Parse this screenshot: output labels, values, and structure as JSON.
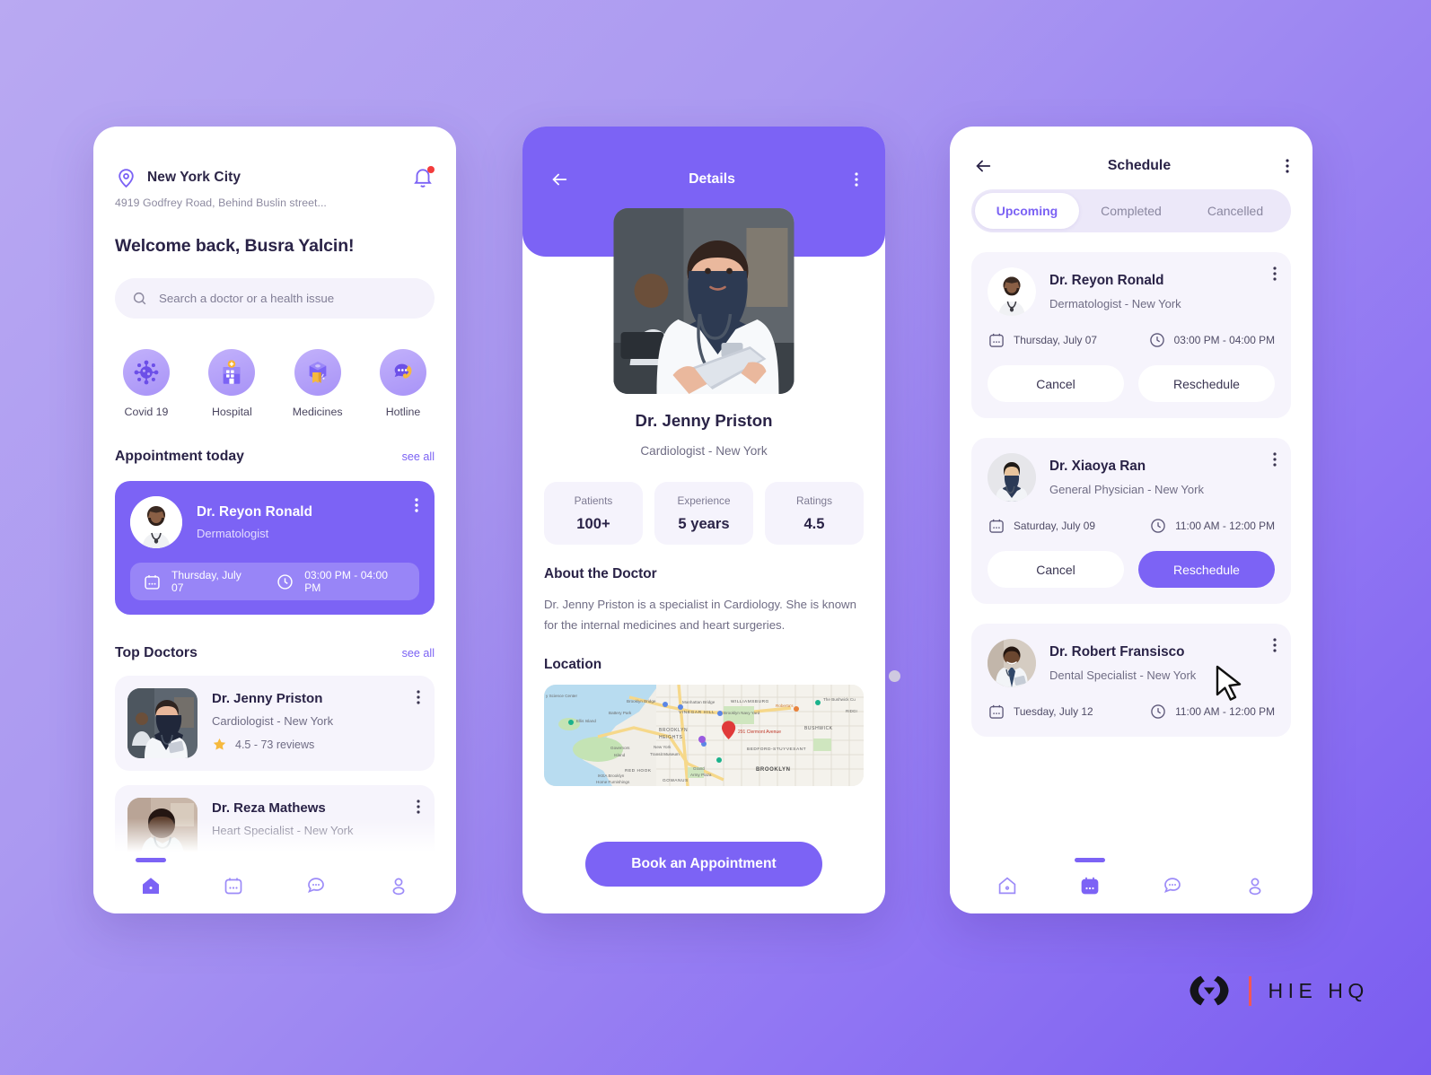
{
  "brand": {
    "name": "HIE HQ",
    "accent": "#7c63f5",
    "divider_color": "#f25757",
    "background_from": "#b9a9f2",
    "background_to": "#7a5cf0"
  },
  "home": {
    "location": {
      "city": "New York City",
      "address": "4919 Godfrey Road, Behind Buslin street..."
    },
    "greeting": "Welcome back, Busra Yalcin!",
    "search": {
      "placeholder": "Search a doctor or a health issue",
      "value": ""
    },
    "categories": [
      {
        "label": "Covid 19",
        "icon": "virus-icon"
      },
      {
        "label": "Hospital",
        "icon": "hospital-icon"
      },
      {
        "label": "Medicines",
        "icon": "medicine-box-icon"
      },
      {
        "label": "Hotline",
        "icon": "hotline-icon"
      }
    ],
    "appointment_section": {
      "title": "Appointment today",
      "see_all": "see all"
    },
    "appointment": {
      "doctor": "Dr. Reyon Ronald",
      "specialty": "Dermatologist",
      "date": "Thursday, July 07",
      "time": "03:00 PM - 04:00 PM"
    },
    "top_doctors_section": {
      "title": "Top Doctors",
      "see_all": "see all"
    },
    "top_doctors": [
      {
        "name": "Dr. Jenny Priston",
        "specialty": "Cardiologist - New York",
        "rating": "4.5 - 73 reviews"
      },
      {
        "name": "Dr. Reza Mathews",
        "specialty": "Heart Specialist - New York",
        "rating": ""
      }
    ],
    "tabs": [
      {
        "icon": "home-icon",
        "active": true
      },
      {
        "icon": "calendar-icon",
        "active": false
      },
      {
        "icon": "chat-icon",
        "active": false
      },
      {
        "icon": "profile-icon",
        "active": false
      }
    ]
  },
  "details": {
    "title": "Details",
    "doctor": {
      "name": "Dr. Jenny Priston",
      "specialty": "Cardiologist - New York"
    },
    "stats": [
      {
        "label": "Patients",
        "value": "100+"
      },
      {
        "label": "Experience",
        "value": "5 years"
      },
      {
        "label": "Ratings",
        "value": "4.5"
      }
    ],
    "about_heading": "About the Doctor",
    "about_text": "Dr. Jenny Priston is a specialist in Cardiology. She is known for the internal medicines and heart surgeries.",
    "location_heading": "Location",
    "map": {
      "marker_label": "291 Clermont Avenue",
      "places": [
        "y Science Center",
        "Brooklyn Bridge",
        "Manhattan Bridge",
        "WILLIAMSBURG",
        "The Bushwick Co",
        "Roberta's",
        "Battery Park",
        "VINEGAR HILL",
        "Brooklyn Navy Yard",
        "RIDGE",
        "Ellis Island",
        "BROOKLYN HEIGHTS",
        "BUSHWICK",
        "Governors Island",
        "New York Transit Museum",
        "BEDFORD-STUYVESANT",
        "RED HOOK",
        "BROOKLYN",
        "Grand Army Plaza",
        "IKEA Brooklyn Home Furnishings",
        "GOWANUS"
      ]
    },
    "cta": "Book an Appointment"
  },
  "schedule": {
    "title": "Schedule",
    "tabs": [
      {
        "label": "Upcoming",
        "active": true
      },
      {
        "label": "Completed",
        "active": false
      },
      {
        "label": "Cancelled",
        "active": false
      }
    ],
    "appointments": [
      {
        "name": "Dr. Reyon Ronald",
        "specialty": "Dermatologist - New York",
        "date": "Thursday, July 07",
        "time": "03:00 PM - 04:00 PM",
        "cancel": "Cancel",
        "reschedule": "Reschedule",
        "reschedule_primary": false
      },
      {
        "name": "Dr. Xiaoya Ran",
        "specialty": "General Physician - New York",
        "date": "Saturday, July 09",
        "time": "11:00 AM - 12:00 PM",
        "cancel": "Cancel",
        "reschedule": "Reschedule",
        "reschedule_primary": true
      },
      {
        "name": "Dr. Robert Fransisco",
        "specialty": "Dental Specialist - New York",
        "date": "Tuesday, July 12",
        "time": "11:00 AM - 12:00 PM",
        "cancel": "",
        "reschedule": "",
        "reschedule_primary": false
      }
    ],
    "tabs_bottom": [
      {
        "icon": "home-icon",
        "active": false
      },
      {
        "icon": "calendar-icon",
        "active": true
      },
      {
        "icon": "chat-icon",
        "active": false
      },
      {
        "icon": "profile-icon",
        "active": false
      }
    ]
  }
}
